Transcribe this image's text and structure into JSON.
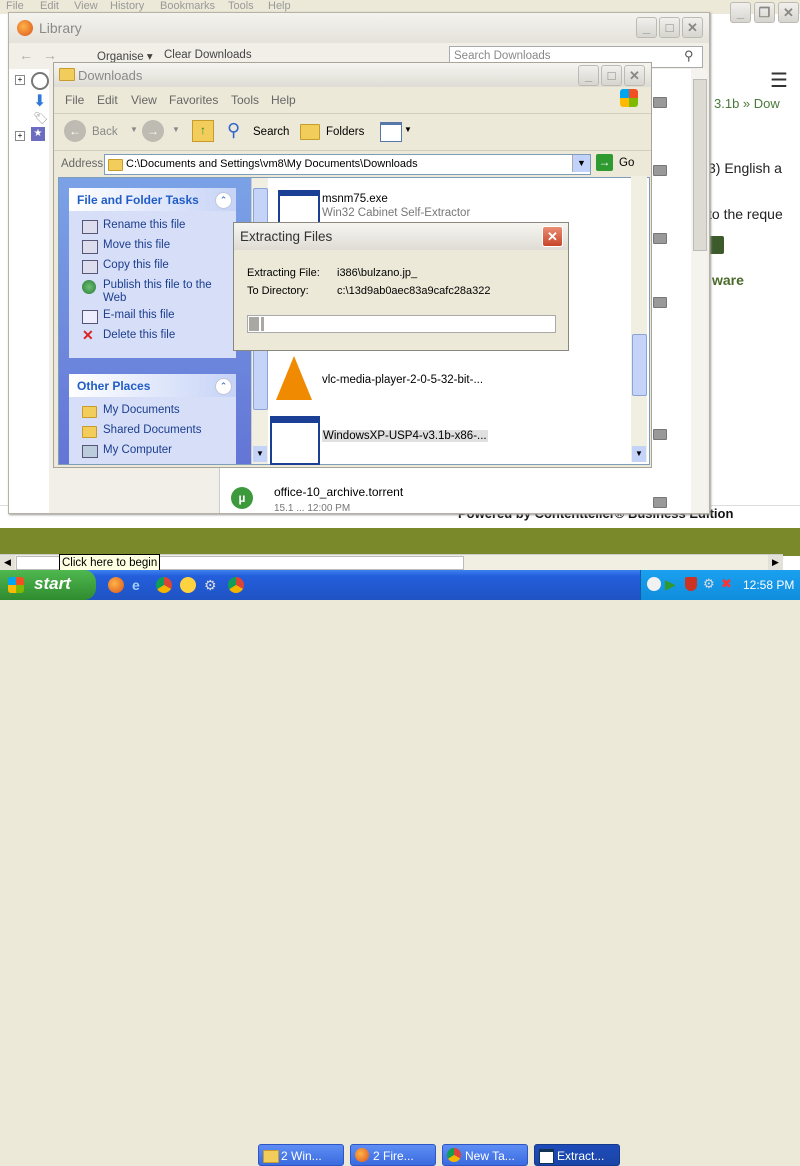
{
  "browser_menu": [
    "File",
    "Edit",
    "View",
    "History",
    "Bookmarks",
    "Tools",
    "Help"
  ],
  "browser_page": {
    "breadcrumb": "3.1b » Dow",
    "english_text": "3) English a",
    "request_text": "to the reque",
    "ware_text": "ware",
    "powered_by": "Powered by Contentteller® Business Edition"
  },
  "library": {
    "title": "Library",
    "organise": "Organise ▾",
    "clear_downloads": "Clear Downloads",
    "search_placeholder": "Search Downloads",
    "download_name": "office-10_archive.torrent",
    "download_status": "15.1 ... 12:00 PM"
  },
  "explorer": {
    "title": "Downloads",
    "menu": [
      "File",
      "Edit",
      "View",
      "Favorites",
      "Tools",
      "Help"
    ],
    "toolbar": {
      "back": "Back",
      "search": "Search",
      "folders": "Folders"
    },
    "address_label": "Address",
    "address_value": "C:\\Documents and Settings\\vm8\\My Documents\\Downloads",
    "go": "Go",
    "file_tasks": {
      "title": "File and Folder Tasks",
      "items": [
        "Rename this file",
        "Move this file",
        "Copy this file",
        "Publish this file to the Web",
        "E-mail this file",
        "Delete this file"
      ]
    },
    "other_places": {
      "title": "Other Places",
      "items": [
        "My Documents",
        "Shared Documents",
        "My Computer"
      ]
    },
    "files": [
      {
        "name": "msnm75.exe",
        "desc": "Win32 Cabinet Self-Extractor"
      },
      {
        "name": "vlc-media-player-2-0-5-32-bit-..."
      },
      {
        "name": "WindowsXP-USP4-v3.1b-x86-..."
      }
    ]
  },
  "dialog": {
    "title": "Extracting Files",
    "file_label": "Extracting File:",
    "file_value": "i386\\bulzano.jp_",
    "dir_label": "To Directory:",
    "dir_value": "c:\\13d9ab0aec83a9cafc28a322",
    "progress": 0.05
  },
  "tooltip": "Click here to begin",
  "taskbar": {
    "start": "start",
    "buttons": [
      "2 Win...",
      "2 Fire...",
      "New Ta...",
      "Extract..."
    ],
    "clock": "12:58 PM"
  },
  "colors": {
    "taskbar": "#245edb",
    "start": "#3c9a3c",
    "xp_title": "#0054e3"
  }
}
